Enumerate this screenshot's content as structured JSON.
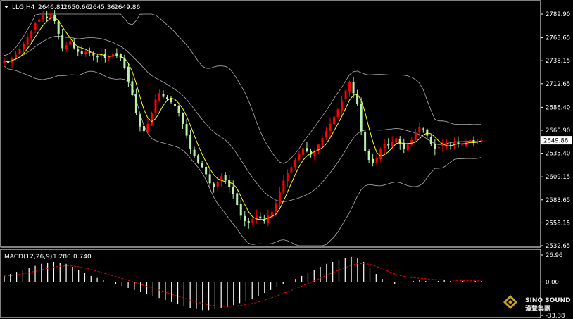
{
  "window": {
    "symbol_label": "LLG,H4",
    "ohlc": [
      "2646.81",
      "2650.66",
      "2645.36",
      "2649.86"
    ]
  },
  "colors": {
    "background": "#000000",
    "bull_candle": "#ff0000",
    "bear_candle": "#b8f0b0",
    "ma_line": "#ffff00",
    "bollinger": "#b0b0b0",
    "macd_hist": "#ffffff",
    "macd_signal": "#ff0000",
    "grid_frame": "#ffffff",
    "price_tag_bg": "#ffffff"
  },
  "chart_data": [
    {
      "type": "candlestick",
      "title": "LLG,H4",
      "price_scale": {
        "ylim": [
          2532.65,
          2789.9
        ],
        "tick_labels": [
          "2789.90",
          "2763.65",
          "2738.15",
          "2712.65",
          "2686.40",
          "2660.90",
          "2635.40",
          "2609.15",
          "2583.65",
          "2558.15",
          "2532.65"
        ]
      },
      "current_price": "2649.86",
      "candles_per_step_estimate": "approximate readings",
      "close_series": [
        2738,
        2736,
        2741,
        2745,
        2751,
        2757,
        2764,
        2771,
        2780,
        2784,
        2788,
        2786,
        2790,
        2782,
        2768,
        2752,
        2755,
        2760,
        2752,
        2748,
        2746,
        2748,
        2747,
        2744,
        2742,
        2745,
        2741,
        2743,
        2746,
        2744,
        2741,
        2730,
        2715,
        2700,
        2680,
        2665,
        2660,
        2668,
        2680,
        2695,
        2702,
        2698,
        2696,
        2692,
        2688,
        2680,
        2668,
        2655,
        2640,
        2632,
        2625,
        2620,
        2612,
        2602,
        2598,
        2604,
        2610,
        2605,
        2598,
        2590,
        2578,
        2566,
        2560,
        2558,
        2562,
        2566,
        2563,
        2560,
        2566,
        2570,
        2580,
        2592,
        2605,
        2614,
        2620,
        2628,
        2635,
        2641,
        2638,
        2634,
        2638,
        2645,
        2652,
        2660,
        2668,
        2676,
        2684,
        2694,
        2705,
        2714,
        2702,
        2690,
        2660,
        2638,
        2628,
        2625,
        2630,
        2640,
        2646,
        2644,
        2648,
        2652,
        2646,
        2640,
        2645,
        2650,
        2658,
        2664,
        2662,
        2655,
        2646,
        2640,
        2642,
        2645,
        2646,
        2644,
        2648,
        2646,
        2645,
        2648,
        2650,
        2647,
        2649,
        2650
      ]
    },
    {
      "type": "macd",
      "title": "MACD(12,26,9)",
      "params": "MACD(12,26,9)",
      "values": {
        "macd": "1.280",
        "signal": "0.740"
      },
      "ylim": [
        -33.38,
        26.96
      ],
      "tick_labels": [
        "26.96",
        "0.00",
        "-33.38"
      ],
      "hist_series": [
        6,
        8,
        10,
        12,
        14,
        16,
        18,
        19,
        20,
        19,
        18,
        15,
        12,
        9,
        6,
        4,
        2,
        0,
        -2,
        -4,
        -6,
        -8,
        -10,
        -12,
        -14,
        -16,
        -18,
        -20,
        -22,
        -24,
        -26,
        -27,
        -28,
        -28,
        -27,
        -26,
        -25,
        -23,
        -21,
        -19,
        -17,
        -14,
        -11,
        -8,
        -5,
        -2,
        0,
        3,
        6,
        9,
        12,
        15,
        18,
        20,
        22,
        24,
        25,
        24,
        20,
        14,
        8,
        3,
        0,
        -2,
        -1,
        0,
        1,
        2,
        1,
        0,
        1,
        2,
        1,
        0,
        1,
        0,
        1,
        1
      ]
    }
  ],
  "branding": {
    "line1": "SINO SOUND",
    "line2": "漢聲集團"
  }
}
